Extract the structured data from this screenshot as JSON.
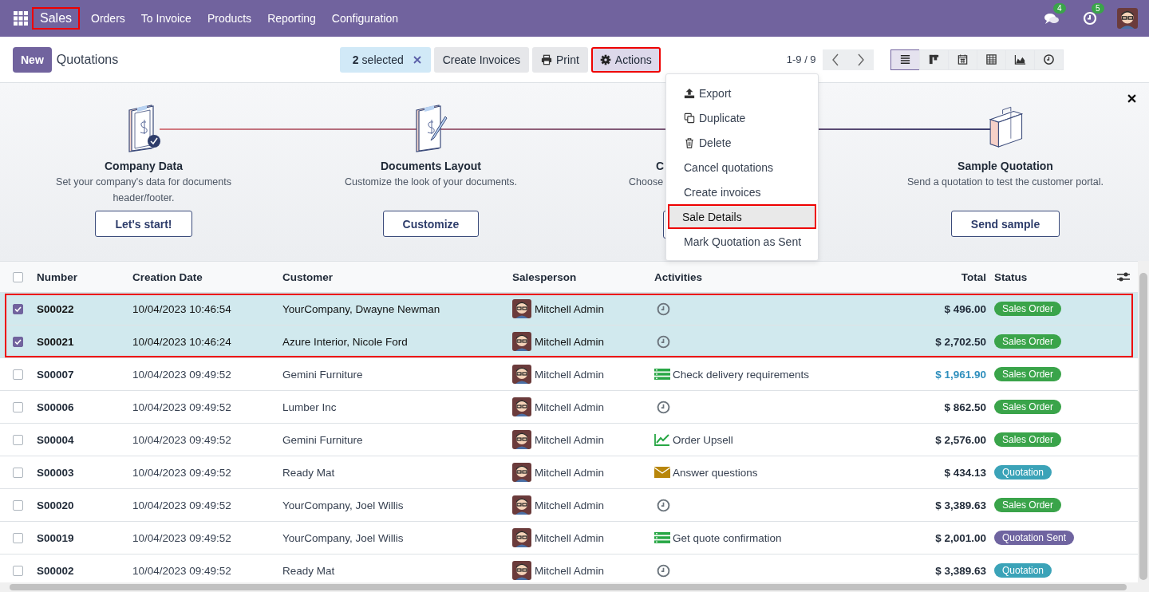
{
  "navbar": {
    "app": "Sales",
    "app_annotated": true,
    "menu": [
      "Orders",
      "To Invoice",
      "Products",
      "Reporting",
      "Configuration"
    ],
    "messages_count": "4",
    "activities_count": "5"
  },
  "control_bar": {
    "new_button": "New",
    "title": "Quotations",
    "selection": {
      "count": "2",
      "label": "selected"
    },
    "buttons": [
      {
        "kind": "text",
        "label": "Create Invoices",
        "annotated": false
      },
      {
        "kind": "print",
        "label": "Print",
        "annotated": false
      },
      {
        "kind": "gear",
        "label": "Actions",
        "annotated": true
      }
    ],
    "pager": "1-9 / 9",
    "views": [
      {
        "kind": "list",
        "selected": true
      },
      {
        "kind": "kanban",
        "selected": false
      },
      {
        "kind": "calendar",
        "selected": false
      },
      {
        "kind": "pivot",
        "selected": false
      },
      {
        "kind": "graph",
        "selected": false
      },
      {
        "kind": "activity",
        "selected": false
      }
    ]
  },
  "onboarding": {
    "steps": [
      {
        "kind": "clipboard-check",
        "title": "Company Data",
        "description": "Set your company's data for documents header/footer.",
        "button": "Let's start!"
      },
      {
        "kind": "clipboard-pen",
        "title": "Documents Layout",
        "description": "Customize the look of your documents.",
        "button": "Customize"
      },
      {
        "kind": "hidden",
        "title": "C",
        "description": "Choose"
      },
      {
        "kind": "bag",
        "title": "Sample Quotation",
        "description": "Send a quotation to test the customer portal.",
        "button": "Send sample"
      }
    ]
  },
  "actions_menu": [
    {
      "kind": "export",
      "label": "Export",
      "selected": false
    },
    {
      "kind": "duplicate",
      "label": "Duplicate",
      "selected": false
    },
    {
      "kind": "delete",
      "label": "Delete",
      "selected": false
    },
    {
      "kind": "plain",
      "label": "Cancel quotations",
      "selected": false
    },
    {
      "kind": "plain",
      "label": "Create invoices",
      "selected": false
    },
    {
      "kind": "plain",
      "label": "Sale Details",
      "selected": true
    },
    {
      "kind": "plain",
      "label": "Mark Quotation as Sent",
      "selected": false
    }
  ],
  "table": {
    "all_selected": false,
    "columns": [
      "Number",
      "Creation Date",
      "Customer",
      "Salesperson",
      "Activities",
      "Total",
      "Status"
    ],
    "rows": [
      {
        "selected": true,
        "number": "S00022",
        "date": "10/04/2023 10:46:54",
        "customer": "YourCompany, Dwayne Newman",
        "salesperson": "Mitchell Admin",
        "activity": {
          "kind": "clock"
        },
        "total": "$ 496.00",
        "overdue": false,
        "status": {
          "kind": "sales-order",
          "label": "Sales Order"
        }
      },
      {
        "selected": true,
        "number": "S00021",
        "date": "10/04/2023 10:46:24",
        "customer": "Azure Interior, Nicole Ford",
        "salesperson": "Mitchell Admin",
        "activity": {
          "kind": "clock"
        },
        "total": "$ 2,702.50",
        "overdue": false,
        "status": {
          "kind": "sales-order",
          "label": "Sales Order"
        }
      },
      {
        "selected": false,
        "number": "S00007",
        "date": "10/04/2023 09:49:52",
        "customer": "Gemini Furniture",
        "salesperson": "Mitchell Admin",
        "activity": {
          "kind": "todo",
          "label": "Check delivery requirements"
        },
        "total": "$ 1,961.90",
        "overdue": true,
        "status": {
          "kind": "sales-order",
          "label": "Sales Order"
        }
      },
      {
        "selected": false,
        "number": "S00006",
        "date": "10/04/2023 09:49:52",
        "customer": "Lumber Inc",
        "salesperson": "Mitchell Admin",
        "activity": {
          "kind": "clock"
        },
        "total": "$ 862.50",
        "overdue": false,
        "status": {
          "kind": "sales-order",
          "label": "Sales Order"
        }
      },
      {
        "selected": false,
        "number": "S00004",
        "date": "10/04/2023 09:49:52",
        "customer": "Gemini Furniture",
        "salesperson": "Mitchell Admin",
        "activity": {
          "kind": "upsell",
          "label": "Order Upsell"
        },
        "total": "$ 2,576.00",
        "overdue": false,
        "status": {
          "kind": "sales-order",
          "label": "Sales Order"
        }
      },
      {
        "selected": false,
        "number": "S00003",
        "date": "10/04/2023 09:49:52",
        "customer": "Ready Mat",
        "salesperson": "Mitchell Admin",
        "activity": {
          "kind": "email",
          "label": "Answer questions"
        },
        "total": "$ 434.13",
        "overdue": false,
        "status": {
          "kind": "quotation",
          "label": "Quotation"
        }
      },
      {
        "selected": false,
        "number": "S00020",
        "date": "10/04/2023 09:49:52",
        "customer": "YourCompany, Joel Willis",
        "salesperson": "Mitchell Admin",
        "activity": {
          "kind": "clock"
        },
        "total": "$ 3,389.63",
        "overdue": false,
        "status": {
          "kind": "sales-order",
          "label": "Sales Order"
        }
      },
      {
        "selected": false,
        "number": "S00019",
        "date": "10/04/2023 09:49:52",
        "customer": "YourCompany, Joel Willis",
        "salesperson": "Mitchell Admin",
        "activity": {
          "kind": "todo",
          "label": "Get quote confirmation"
        },
        "total": "$ 2,001.00",
        "overdue": false,
        "status": {
          "kind": "sent",
          "label": "Quotation Sent"
        }
      },
      {
        "selected": false,
        "number": "S00002",
        "date": "10/04/2023 09:49:52",
        "customer": "Ready Mat",
        "salesperson": "Mitchell Admin",
        "activity": {
          "kind": "clock"
        },
        "total": "$ 3,389.63",
        "overdue": false,
        "status": {
          "kind": "quotation",
          "label": "Quotation"
        }
      }
    ]
  }
}
